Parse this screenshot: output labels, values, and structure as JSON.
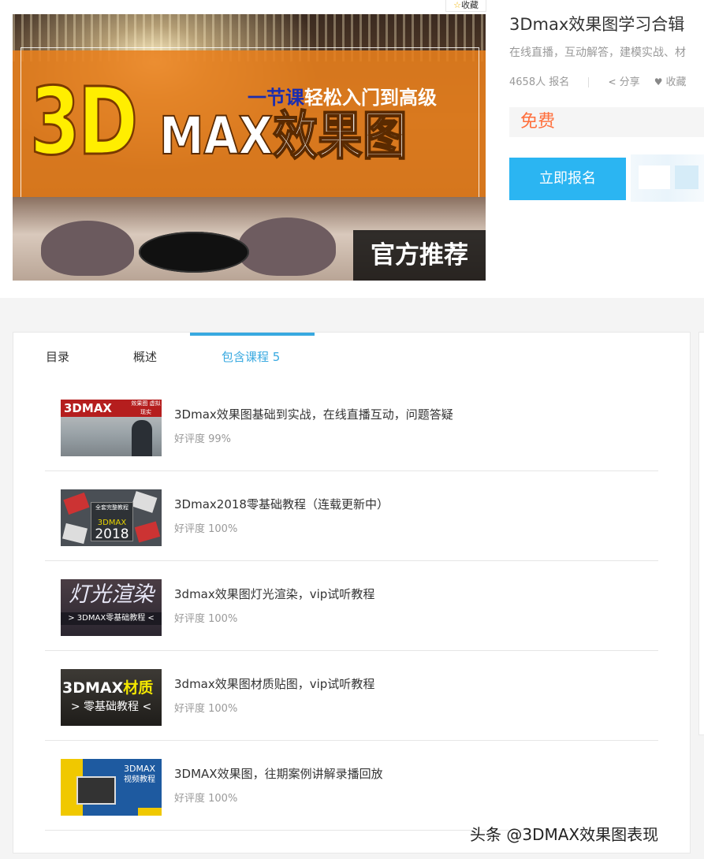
{
  "header": {
    "favorite_chip": "收藏",
    "cover": {
      "headline_3d": "3D",
      "headline_max": "MAX效果图",
      "subtitle_highlight": "一节课",
      "subtitle_rest": "轻松入门到高级",
      "badge": "官方推荐"
    },
    "title": "3Dmax效果图学习合辑",
    "description": "在线直播，互动解答，建模实战、材",
    "enroll_count": "4658人 报名",
    "share_label": "分享",
    "favorite_label": "收藏",
    "price": "免费",
    "enroll_button": "立即报名"
  },
  "tabs": [
    {
      "label": "目录"
    },
    {
      "label": "概述"
    },
    {
      "label": "包含课程 5",
      "active": true
    }
  ],
  "courses": [
    {
      "title": "3Dmax效果图基础到实战，在线直播互动，问题答疑",
      "rating": "好评度 99%",
      "thumb": {
        "label": "3DMAX",
        "sub": "效果图 虚拟现实"
      }
    },
    {
      "title": "3Dmax2018零基础教程（连载更新中）",
      "rating": "好评度 100%",
      "thumb": {
        "line1": "全套完整教程",
        "line2": "3DMAX",
        "line3": "2018"
      }
    },
    {
      "title": "3dmax效果图灯光渲染，vip试听教程",
      "rating": "好评度 100%",
      "thumb": {
        "big": "灯光渲染",
        "small": "> 3DMAX零基础教程 <"
      }
    },
    {
      "title": "3dmax效果图材质贴图，vip试听教程",
      "rating": "好评度 100%",
      "thumb": {
        "big_a": "3DMAX",
        "big_b": "材质",
        "small": "> 零基础教程 <"
      }
    },
    {
      "title": "3DMAX效果图，往期案例讲解录播回放",
      "rating": "好评度 100%",
      "thumb": {
        "line1": "3DMAX",
        "line2": "视频教程"
      }
    }
  ],
  "watermark": "头条 @3DMAX效果图表现",
  "colors": {
    "accent": "#2bb5f2",
    "tab_active": "#38a9e0",
    "price": "#ff6f3c",
    "page_gray": "#f4f4f4"
  }
}
